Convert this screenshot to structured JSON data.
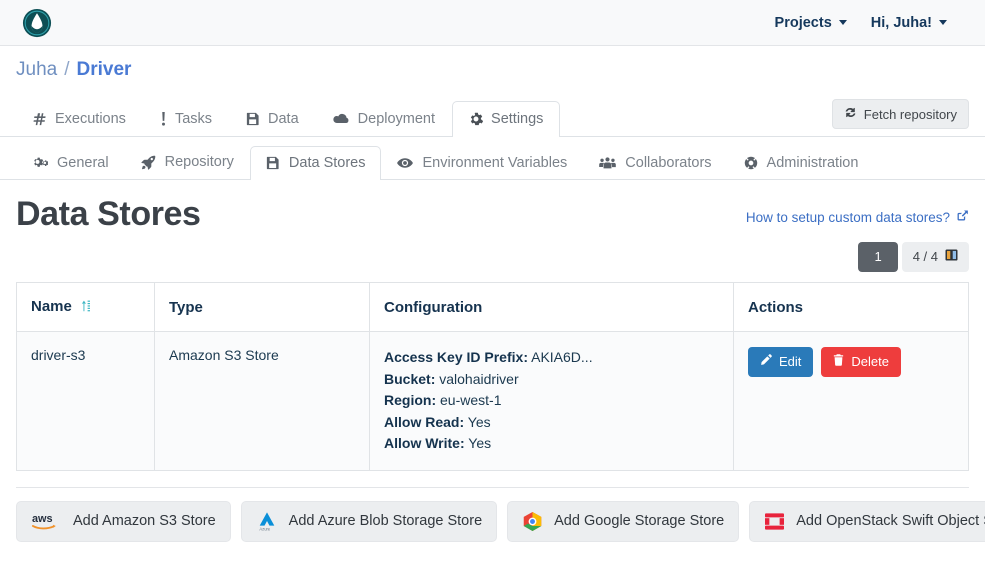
{
  "navbar": {
    "logo_icon": "valohai-logo-icon",
    "projects_label": "Projects",
    "user_label": "Hi, Juha!"
  },
  "breadcrumb": {
    "root": "Juha",
    "separator": "/",
    "current": "Driver"
  },
  "primary_tabs": [
    {
      "label": "Executions",
      "icon": "hash-icon",
      "active": false
    },
    {
      "label": "Tasks",
      "icon": "exclamation-icon",
      "active": false
    },
    {
      "label": "Data",
      "icon": "floppy-disk-icon",
      "active": false
    },
    {
      "label": "Deployment",
      "icon": "cloud-icon",
      "active": false
    },
    {
      "label": "Settings",
      "icon": "gear-icon",
      "active": true
    }
  ],
  "fetch_repository": {
    "label": "Fetch repository",
    "icon": "sync-icon"
  },
  "secondary_tabs": [
    {
      "label": "General",
      "icon": "cogs-icon",
      "active": false
    },
    {
      "label": "Repository",
      "icon": "rocket-icon",
      "active": false
    },
    {
      "label": "Data Stores",
      "icon": "floppy-disk-icon",
      "active": true
    },
    {
      "label": "Environment Variables",
      "icon": "eye-icon",
      "active": false
    },
    {
      "label": "Collaborators",
      "icon": "users-icon",
      "active": false
    },
    {
      "label": "Administration",
      "icon": "life-ring-icon",
      "active": false
    }
  ],
  "page": {
    "title": "Data Stores",
    "help_link": "How to setup custom data stores?",
    "help_link_icon": "external-link-icon"
  },
  "pager": {
    "current_page": "1",
    "count_label": "4 / 4",
    "columns_icon": "columns-icon"
  },
  "table": {
    "columns": [
      "Name",
      "Type",
      "Configuration",
      "Actions"
    ],
    "sort_icon": "sort-updown-icon",
    "rows": [
      {
        "name": "driver-s3",
        "type": "Amazon S3 Store",
        "configuration": [
          {
            "key": "Access Key ID Prefix",
            "value": "AKIA6D..."
          },
          {
            "key": "Bucket",
            "value": "valohaidriver"
          },
          {
            "key": "Region",
            "value": "eu-west-1"
          },
          {
            "key": "Allow Read",
            "value": "Yes"
          },
          {
            "key": "Allow Write",
            "value": "Yes"
          }
        ],
        "actions": [
          {
            "label": "Edit",
            "icon": "pencil-icon",
            "style": "edit"
          },
          {
            "label": "Delete",
            "icon": "trash-icon",
            "style": "delete"
          }
        ]
      }
    ]
  },
  "add_buttons": [
    {
      "label": "Add Amazon S3 Store",
      "icon": "aws-logo-icon"
    },
    {
      "label": "Add Azure Blob Storage Store",
      "icon": "azure-logo-icon"
    },
    {
      "label": "Add Google Storage Store",
      "icon": "google-cloud-logo-icon"
    },
    {
      "label": "Add OpenStack Swift Object Store",
      "icon": "openstack-logo-icon"
    }
  ],
  "colors": {
    "accent_blue": "#4a7ad4",
    "link_blue": "#3c6fc4",
    "edit_blue": "#2a7ab9",
    "delete_red": "#ee3d3d",
    "sort_teal": "#3cb6c3",
    "logo_teal": "#0d4f55",
    "pager_dark": "#5b6168"
  }
}
